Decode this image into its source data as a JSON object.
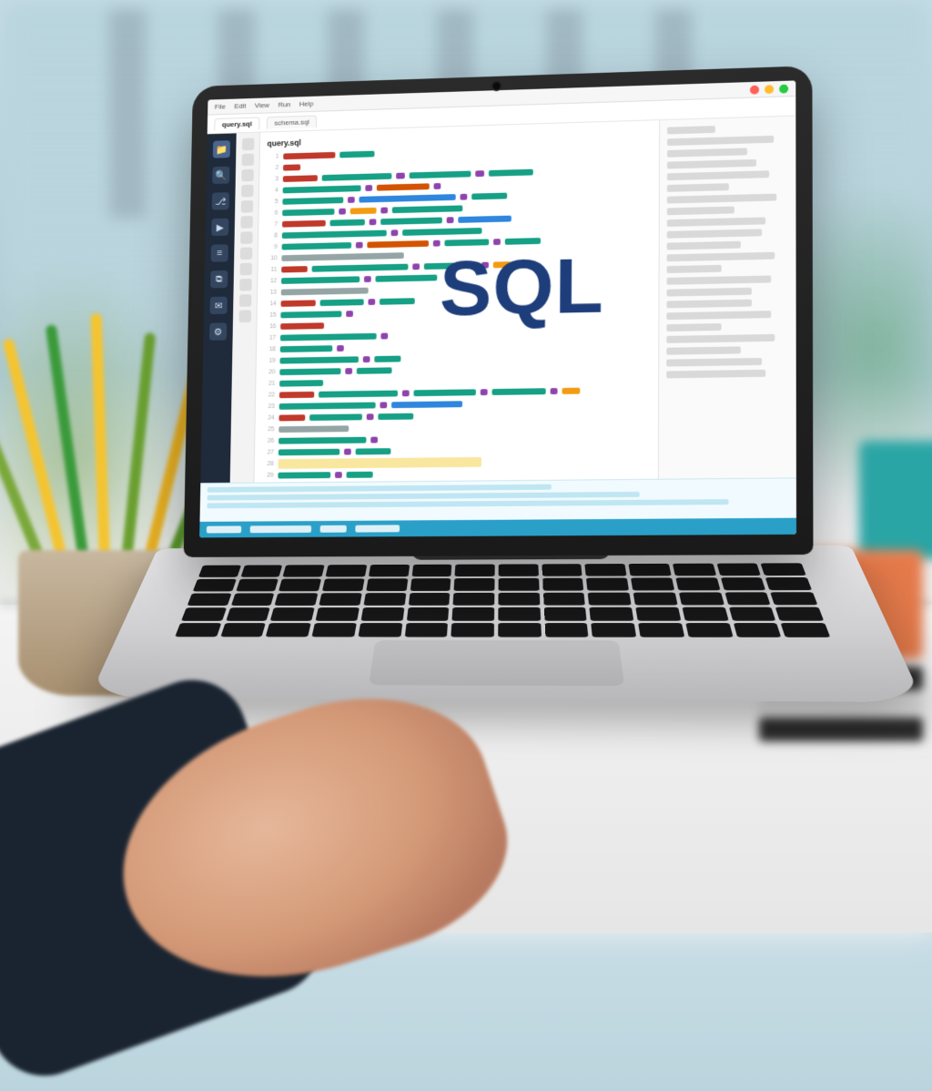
{
  "scene": {
    "overlay_text": "SQL",
    "overlay_color": "#1d3e7a"
  },
  "menubar": {
    "items": [
      "File",
      "Edit",
      "View",
      "Run",
      "Help"
    ]
  },
  "toolbar": {
    "tabs": [
      {
        "label": "query.sql",
        "active": true
      },
      {
        "label": "schema.sql",
        "active": false
      }
    ]
  },
  "activitybar": {
    "icons": [
      {
        "name": "explorer-icon",
        "glyph": "📁",
        "active": true
      },
      {
        "name": "search-icon",
        "glyph": "🔍",
        "active": false
      },
      {
        "name": "source-control-icon",
        "glyph": "⎇",
        "active": false
      },
      {
        "name": "run-icon",
        "glyph": "▶",
        "active": false
      },
      {
        "name": "database-icon",
        "glyph": "≡",
        "active": false
      },
      {
        "name": "extensions-icon",
        "glyph": "⧉",
        "active": false
      },
      {
        "name": "chat-icon",
        "glyph": "✉",
        "active": false
      },
      {
        "name": "gear-icon",
        "glyph": "⚙",
        "active": false
      }
    ]
  },
  "editor": {
    "title": "query.sql",
    "token_colors": {
      "kw": "#c0392b",
      "id": "#16a085",
      "str": "#2e86de",
      "num": "#f39c12",
      "op": "#8e44ad",
      "cm": "#95a5a6",
      "fn": "#d35400",
      "hl": "#f9e79f"
    },
    "lines": [
      [
        [
          "kw",
          60
        ],
        [
          "id",
          40
        ]
      ],
      [
        [
          "kw",
          20
        ]
      ],
      [
        [
          "kw",
          40
        ],
        [
          "id",
          80
        ],
        [
          "op",
          10
        ],
        [
          "id",
          70
        ],
        [
          "op",
          10
        ],
        [
          "id",
          50
        ]
      ],
      [
        [
          "id",
          90
        ],
        [
          "op",
          8
        ],
        [
          "fn",
          60
        ],
        [
          "op",
          8
        ]
      ],
      [
        [
          "id",
          70
        ],
        [
          "op",
          8
        ],
        [
          "str",
          110
        ],
        [
          "op",
          8
        ],
        [
          "id",
          40
        ]
      ],
      [
        [
          "id",
          60
        ],
        [
          "op",
          8
        ],
        [
          "num",
          30
        ],
        [
          "op",
          8
        ],
        [
          "id",
          80
        ]
      ],
      [
        [
          "kw",
          50
        ],
        [
          "id",
          40
        ],
        [
          "op",
          8
        ],
        [
          "id",
          70
        ],
        [
          "op",
          8
        ],
        [
          "str",
          60
        ]
      ],
      [
        [
          "id",
          120
        ],
        [
          "op",
          8
        ],
        [
          "id",
          90
        ]
      ],
      [
        [
          "id",
          80
        ],
        [
          "op",
          8
        ],
        [
          "fn",
          70
        ],
        [
          "op",
          8
        ],
        [
          "id",
          50
        ],
        [
          "op",
          8
        ],
        [
          "id",
          40
        ]
      ],
      [
        [
          "cm",
          140
        ]
      ],
      [
        [
          "kw",
          30
        ],
        [
          "id",
          110
        ],
        [
          "op",
          8
        ],
        [
          "id",
          60
        ],
        [
          "op",
          8
        ],
        [
          "num",
          20
        ]
      ],
      [
        [
          "id",
          90
        ],
        [
          "op",
          8
        ],
        [
          "id",
          70
        ]
      ],
      [
        [
          "cm",
          100
        ]
      ],
      [
        [
          "kw",
          40
        ],
        [
          "id",
          50
        ],
        [
          "op",
          8
        ],
        [
          "id",
          40
        ]
      ],
      [
        [
          "id",
          70
        ],
        [
          "op",
          8
        ]
      ],
      [
        [
          "kw",
          50
        ]
      ],
      [
        [
          "id",
          110
        ],
        [
          "op",
          8
        ]
      ],
      [
        [
          "id",
          60
        ],
        [
          "op",
          8
        ]
      ],
      [
        [
          "id",
          90
        ],
        [
          "op",
          8
        ],
        [
          "id",
          30
        ]
      ],
      [
        [
          "id",
          70
        ],
        [
          "op",
          8
        ],
        [
          "id",
          40
        ]
      ],
      [
        [
          "id",
          50
        ]
      ],
      [
        [
          "kw",
          40
        ],
        [
          "id",
          90
        ],
        [
          "op",
          8
        ],
        [
          "id",
          70
        ],
        [
          "op",
          8
        ],
        [
          "id",
          60
        ],
        [
          "op",
          8
        ],
        [
          "num",
          20
        ]
      ],
      [
        [
          "id",
          110
        ],
        [
          "op",
          8
        ],
        [
          "str",
          80
        ]
      ],
      [
        [
          "kw",
          30
        ],
        [
          "id",
          60
        ],
        [
          "op",
          8
        ],
        [
          "id",
          40
        ]
      ],
      [
        [
          "cm",
          80
        ]
      ],
      [
        [
          "id",
          100
        ],
        [
          "op",
          8
        ]
      ],
      [
        [
          "id",
          70
        ],
        [
          "op",
          8
        ],
        [
          "id",
          40
        ]
      ],
      [
        [
          "hl",
          230
        ]
      ],
      [
        [
          "id",
          60
        ],
        [
          "op",
          8
        ],
        [
          "id",
          30
        ]
      ],
      [
        [
          "id",
          50
        ]
      ]
    ]
  },
  "outline": {
    "row_count": 22
  },
  "console": {
    "rows": 3
  },
  "statusbar": {
    "chips": [
      40,
      70,
      30,
      50
    ]
  }
}
